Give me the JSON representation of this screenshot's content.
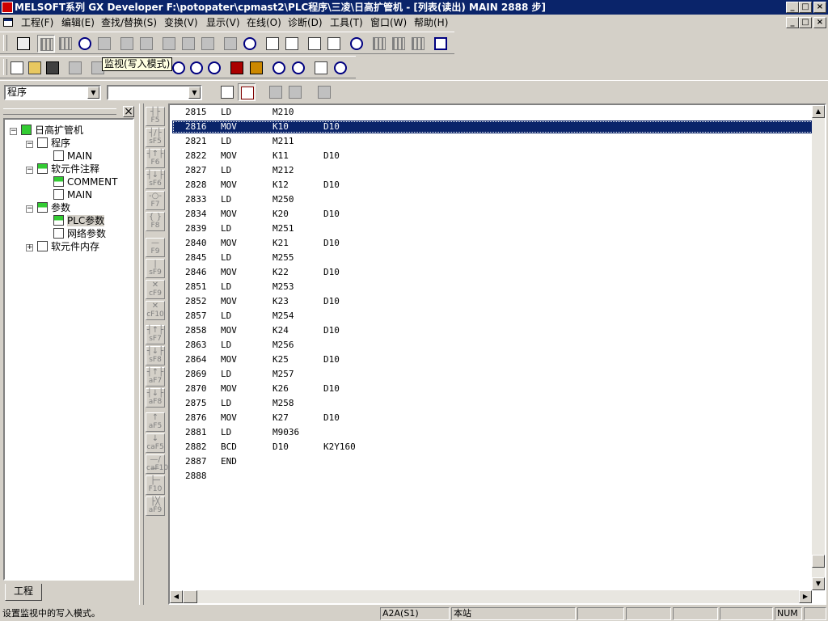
{
  "window": {
    "title": "MELSOFT系列 GX Developer F:\\potopater\\cpmast2\\PLC程序\\三凌\\日高扩管机 - [列表(读出)    MAIN    2888 步]"
  },
  "window_buttons": {
    "minimize": "_",
    "maximize": "□",
    "close": "×"
  },
  "menubar": {
    "items": [
      "工程(F)",
      "编辑(E)",
      "查找/替换(S)",
      "变换(V)",
      "显示(V)",
      "在线(O)",
      "诊断(D)",
      "工具(T)",
      "窗口(W)",
      "帮助(H)"
    ]
  },
  "tooltip": "监视(写入模式)",
  "combos": {
    "data_type": "程序",
    "second": ""
  },
  "tree": {
    "root": "日高扩管机",
    "program": "程序",
    "program_main": "MAIN",
    "comment_group": "软元件注释",
    "comment": "COMMENT",
    "comment_main": "MAIN",
    "params": "参数",
    "plc_params": "PLC参数",
    "net_params": "网络参数",
    "memory": "软元件内存",
    "tab": "工程"
  },
  "fkeys": [
    {
      "sym": "┤├",
      "label": "F5"
    },
    {
      "sym": "┤/├",
      "label": "sF5"
    },
    {
      "sym": "┤↑├",
      "label": "F6"
    },
    {
      "sym": "┤↓├",
      "label": "sF6"
    },
    {
      "sym": "-○-",
      "label": "F7"
    },
    {
      "sym": "{ }",
      "label": "F8"
    },
    {
      "sym": "—",
      "label": "F9"
    },
    {
      "sym": "|",
      "label": "sF9"
    },
    {
      "sym": "✕",
      "label": "cF9"
    },
    {
      "sym": "✕",
      "label": "cF10"
    },
    {
      "sym": "┤↑├",
      "label": "sF7"
    },
    {
      "sym": "┤↓├",
      "label": "sF8"
    },
    {
      "sym": "┤↑├",
      "label": "aF7"
    },
    {
      "sym": "┤↓├",
      "label": "aF8"
    },
    {
      "sym": "↑",
      "label": "aF5"
    },
    {
      "sym": "↓",
      "label": "caF5"
    },
    {
      "sym": "—/—",
      "label": "caF10"
    },
    {
      "sym": "├─",
      "label": "F10"
    },
    {
      "sym": "├╳",
      "label": "aF9"
    }
  ],
  "instructions": [
    {
      "step": "2815",
      "op": "LD",
      "a": "M210",
      "b": ""
    },
    {
      "step": "2816",
      "op": "MOV",
      "a": "K10",
      "b": "D10"
    },
    {
      "step": "2821",
      "op": "LD",
      "a": "M211",
      "b": ""
    },
    {
      "step": "2822",
      "op": "MOV",
      "a": "K11",
      "b": "D10"
    },
    {
      "step": "2827",
      "op": "LD",
      "a": "M212",
      "b": ""
    },
    {
      "step": "2828",
      "op": "MOV",
      "a": "K12",
      "b": "D10"
    },
    {
      "step": "2833",
      "op": "LD",
      "a": "M250",
      "b": ""
    },
    {
      "step": "2834",
      "op": "MOV",
      "a": "K20",
      "b": "D10"
    },
    {
      "step": "2839",
      "op": "LD",
      "a": "M251",
      "b": ""
    },
    {
      "step": "2840",
      "op": "MOV",
      "a": "K21",
      "b": "D10"
    },
    {
      "step": "2845",
      "op": "LD",
      "a": "M255",
      "b": ""
    },
    {
      "step": "2846",
      "op": "MOV",
      "a": "K22",
      "b": "D10"
    },
    {
      "step": "2851",
      "op": "LD",
      "a": "M253",
      "b": ""
    },
    {
      "step": "2852",
      "op": "MOV",
      "a": "K23",
      "b": "D10"
    },
    {
      "step": "2857",
      "op": "LD",
      "a": "M254",
      "b": ""
    },
    {
      "step": "2858",
      "op": "MOV",
      "a": "K24",
      "b": "D10"
    },
    {
      "step": "2863",
      "op": "LD",
      "a": "M256",
      "b": ""
    },
    {
      "step": "2864",
      "op": "MOV",
      "a": "K25",
      "b": "D10"
    },
    {
      "step": "2869",
      "op": "LD",
      "a": "M257",
      "b": ""
    },
    {
      "step": "2870",
      "op": "MOV",
      "a": "K26",
      "b": "D10"
    },
    {
      "step": "2875",
      "op": "LD",
      "a": "M258",
      "b": ""
    },
    {
      "step": "2876",
      "op": "MOV",
      "a": "K27",
      "b": "D10"
    },
    {
      "step": "2881",
      "op": "LD",
      "a": "M9036",
      "b": ""
    },
    {
      "step": "2882",
      "op": "BCD",
      "a": "D10",
      "b": "K2Y160"
    },
    {
      "step": "2887",
      "op": "END",
      "a": "",
      "b": ""
    },
    {
      "step": "2888",
      "op": "",
      "a": "",
      "b": ""
    }
  ],
  "selected_row_index": 1,
  "statusbar": {
    "message": "设置监视中的写入模式。",
    "plc_type": "A2A(S1)",
    "station": "本站",
    "num": "NUM"
  },
  "colors": {
    "selection": "#0a246a",
    "title_bar": "#0a246a",
    "face": "#d4d0c8"
  }
}
